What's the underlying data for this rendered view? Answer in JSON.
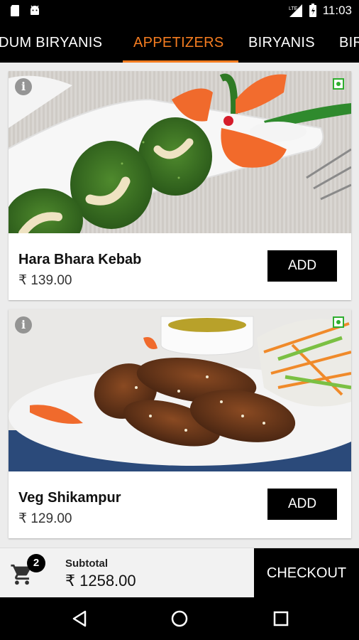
{
  "status": {
    "time": "11:03"
  },
  "tabs": [
    {
      "label": "DUM BIRYANIS"
    },
    {
      "label": "APPETIZERS"
    },
    {
      "label": "BIRYANIS"
    },
    {
      "label": "BIR"
    }
  ],
  "items": [
    {
      "name": "Hara Bhara Kebab",
      "price": "₹ 139.00",
      "add_label": "ADD",
      "veg": true
    },
    {
      "name": "Veg Shikampur",
      "price": "₹ 129.00",
      "add_label": "ADD",
      "veg": true
    }
  ],
  "cart": {
    "count": "2",
    "subtotal_label": "Subtotal",
    "subtotal_value": "₹ 1258.00",
    "checkout_label": "CHECKOUT"
  },
  "colors": {
    "accent": "#f47c20",
    "bar": "#000000",
    "veg": "#2fae2f"
  },
  "icons": [
    "sd-card-icon",
    "android-icon",
    "signal-icon",
    "battery-icon",
    "info-icon",
    "cart-icon",
    "back-icon",
    "home-icon",
    "recents-icon"
  ]
}
